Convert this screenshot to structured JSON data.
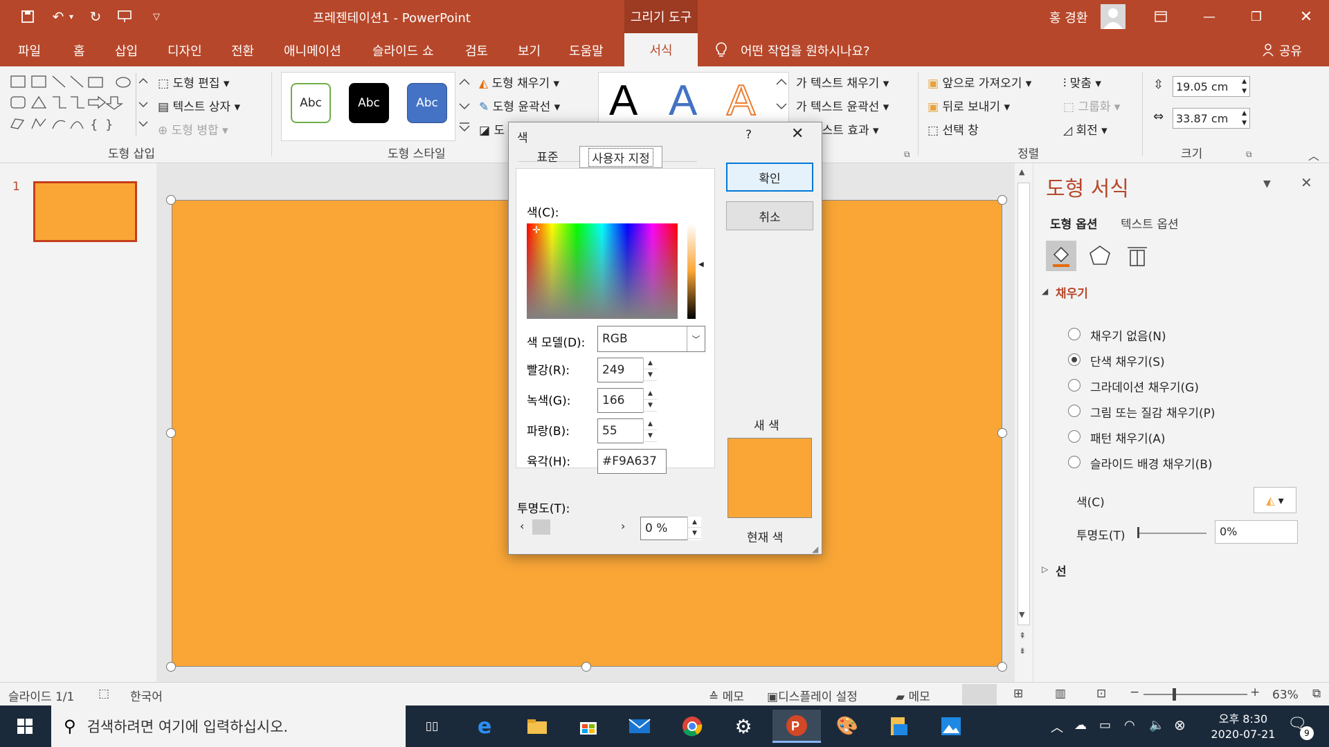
{
  "window": {
    "title": "프레젠테이션1  -  PowerPoint",
    "context_tab": "그리기 도구",
    "user_name": "홍 경환"
  },
  "tabs": [
    "파일",
    "홈",
    "삽입",
    "디자인",
    "전환",
    "애니메이션",
    "슬라이드 쇼",
    "검토",
    "보기",
    "도움말",
    "서식"
  ],
  "active_tab": "서식",
  "tell_me": "어떤 작업을 원하시나요?",
  "share": "공유",
  "ribbon": {
    "groups": {
      "insert_shapes": "도형 삽입",
      "shape_styles": "도형 스타일",
      "arrange": "정렬",
      "size": "크기"
    },
    "edit_shape": "도형 편집",
    "text_box": "텍스트 상자",
    "merge_shapes": "도형 병합",
    "abc": "Abc",
    "shape_fill": "도형 채우기",
    "shape_outline": "도형 윤곽선",
    "shape_effect_partial": "도",
    "text_fill": "텍스트 채우기",
    "text_outline": "텍스트 윤곽선",
    "text_effect_partial": "텍스트 효과",
    "wordart_letter": "A",
    "bring_forward": "앞으로 가져오기",
    "send_backward": "뒤로 보내기",
    "selection_pane": "선택 창",
    "align": "맞춤",
    "group": "그룹화",
    "rotate": "회전",
    "height": "19.05 cm",
    "width": "33.87 cm"
  },
  "thumbnails": {
    "number": "1"
  },
  "format_pane": {
    "title": "도형 서식",
    "tab_shape": "도형 옵션",
    "tab_text": "텍스트 옵션",
    "section_fill": "채우기",
    "options": [
      {
        "label": "채우기 없음(N)",
        "selected": false
      },
      {
        "label": "단색 채우기(S)",
        "selected": true
      },
      {
        "label": "그라데이션 채우기(G)",
        "selected": false
      },
      {
        "label": "그림 또는 질감 채우기(P)",
        "selected": false
      },
      {
        "label": "패턴 채우기(A)",
        "selected": false
      },
      {
        "label": "슬라이드 배경 채우기(B)",
        "selected": false
      }
    ],
    "color_label": "색(C)",
    "transparency_label": "투명도(T)",
    "transparency_value": "0%",
    "section_line": "선"
  },
  "dialog": {
    "title": "색",
    "help": "?",
    "tab_standard": "표준",
    "tab_custom": "사용자 지정",
    "colors_label": "색(C):",
    "model_label": "색 모델(D):",
    "model_value": "RGB",
    "red_label": "빨강(R):",
    "red_value": "249",
    "green_label": "녹색(G):",
    "green_value": "166",
    "blue_label": "파랑(B):",
    "blue_value": "55",
    "hex_label": "육각(H):",
    "hex_value": "#F9A637",
    "transparency_label": "투명도(T):",
    "transparency_value": "0 %",
    "ok": "확인",
    "cancel": "취소",
    "new_color": "새 색",
    "current_color": "현재 색"
  },
  "colors": {
    "accent": "#b7472a",
    "shape_fill": "#f9a637"
  },
  "status": {
    "slide": "슬라이드 1/1",
    "language": "한국어",
    "notes": "메모",
    "display": "디스플레이 설정",
    "comments": "메모",
    "zoom": "63%"
  },
  "taskbar": {
    "search": "검색하려면 여기에 입력하십시오.",
    "time": "오후 8:30",
    "date": "2020-07-21",
    "notif": "9"
  }
}
